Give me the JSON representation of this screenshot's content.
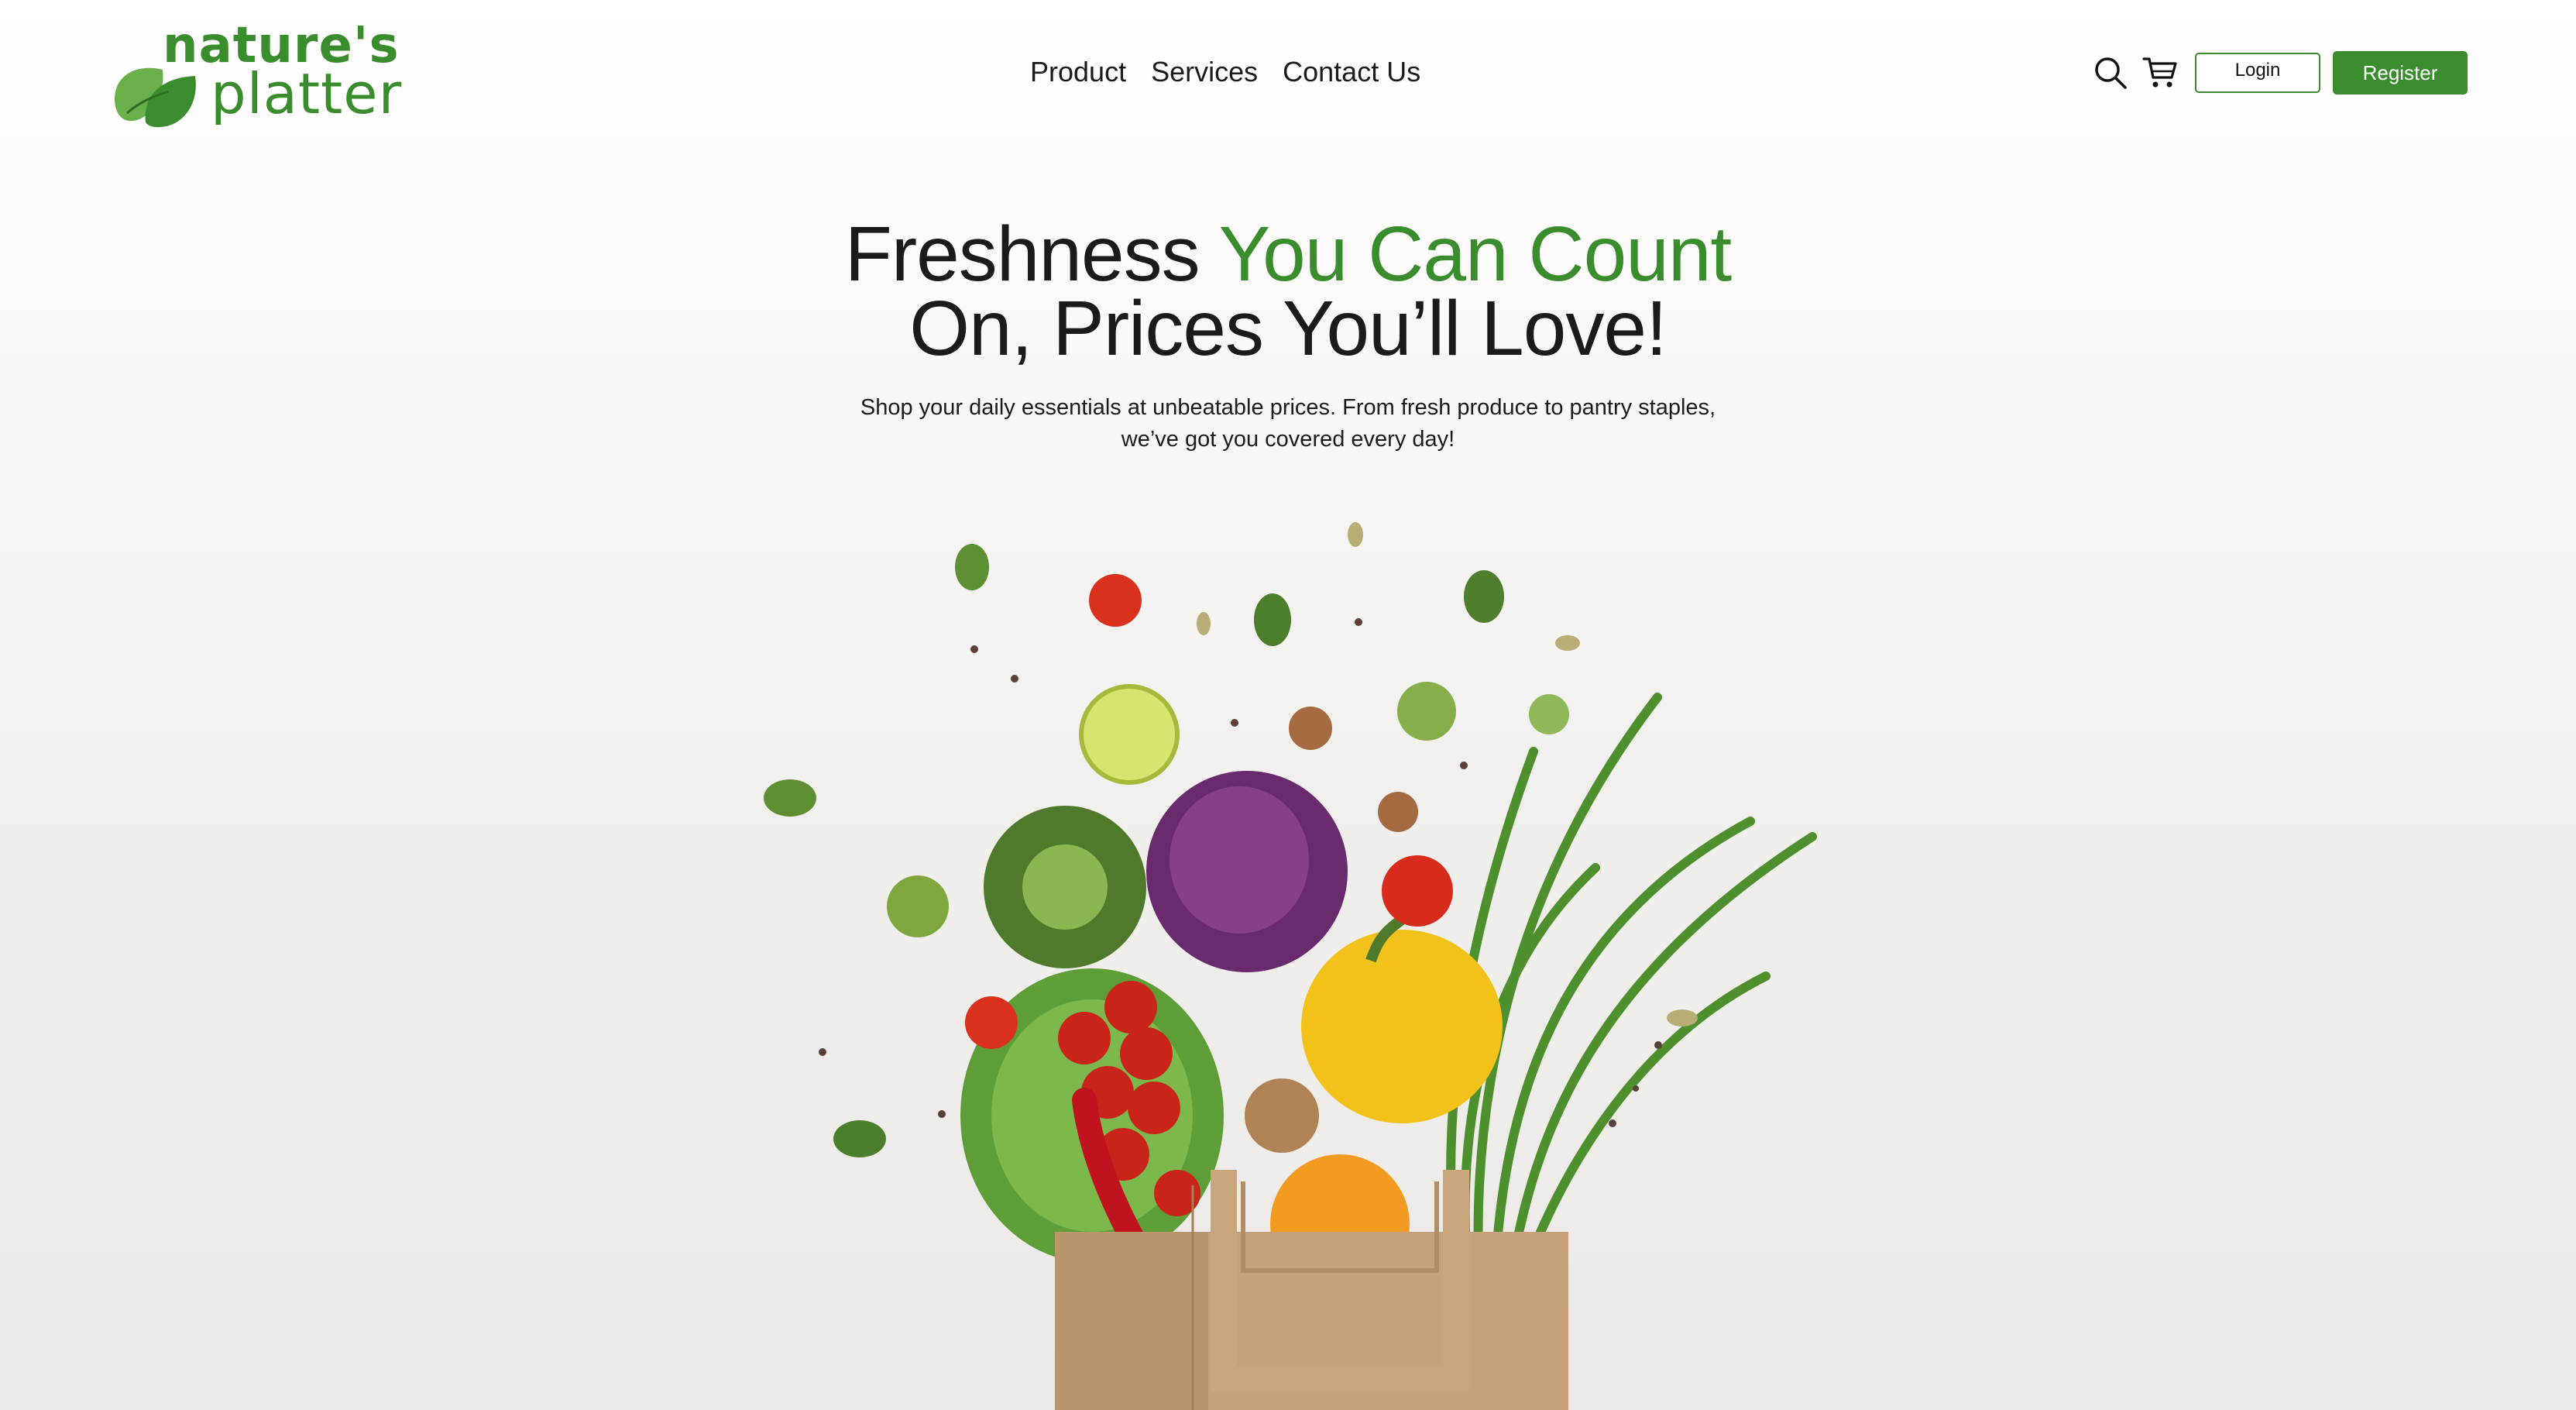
{
  "brand": {
    "name_line1": "nature's",
    "name_line2": "platter",
    "color": "#3a8d2c"
  },
  "nav": {
    "items": [
      "Product",
      "Services",
      "Contact Us"
    ]
  },
  "actions": {
    "search_icon": "search-icon",
    "cart_icon": "cart-icon",
    "login_label": "Login",
    "register_label": "Register"
  },
  "hero": {
    "headline_part1": "Freshness ",
    "headline_highlight": "You Can Count",
    "headline_part2": "On, Prices You’ll Love!",
    "subtext_line1": "Shop your daily essentials at unbeatable prices. From fresh produce to pantry staples,",
    "subtext_line2": "we’ve got you covered every day!"
  },
  "colors": {
    "accent": "#3a8d2c",
    "text": "#1b1b1b"
  }
}
